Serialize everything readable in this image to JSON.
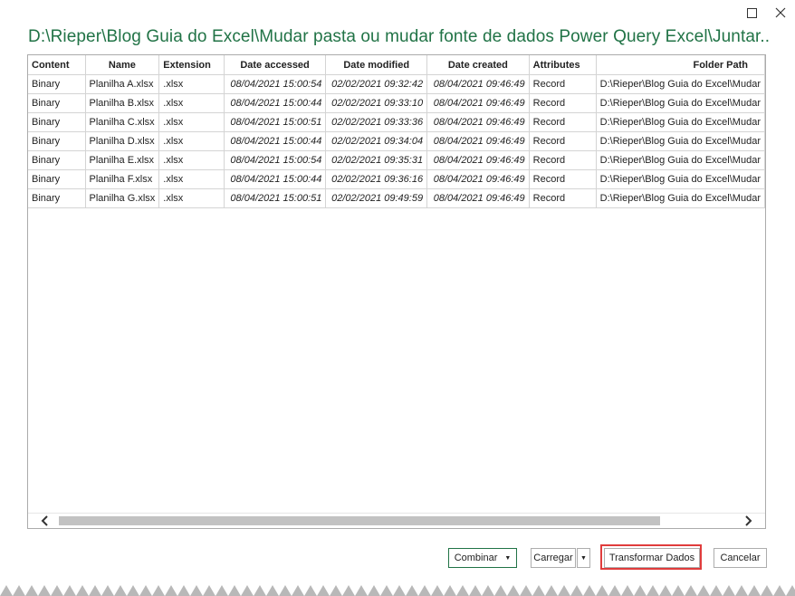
{
  "window": {
    "title": "D:\\Rieper\\Blog Guia do Excel\\Mudar pasta ou mudar fonte de dados Power Query Excel\\Juntar..."
  },
  "table": {
    "columns": [
      "Content",
      "Name",
      "Extension",
      "Date accessed",
      "Date modified",
      "Date created",
      "Attributes",
      "Folder Path"
    ],
    "rows": [
      [
        "Binary",
        "Planilha A.xlsx",
        ".xlsx",
        "08/04/2021 15:00:54",
        "02/02/2021 09:32:42",
        "08/04/2021 09:46:49",
        "Record",
        "D:\\Rieper\\Blog Guia do Excel\\Mudar"
      ],
      [
        "Binary",
        "Planilha B.xlsx",
        ".xlsx",
        "08/04/2021 15:00:44",
        "02/02/2021 09:33:10",
        "08/04/2021 09:46:49",
        "Record",
        "D:\\Rieper\\Blog Guia do Excel\\Mudar"
      ],
      [
        "Binary",
        "Planilha C.xlsx",
        ".xlsx",
        "08/04/2021 15:00:51",
        "02/02/2021 09:33:36",
        "08/04/2021 09:46:49",
        "Record",
        "D:\\Rieper\\Blog Guia do Excel\\Mudar"
      ],
      [
        "Binary",
        "Planilha D.xlsx",
        ".xlsx",
        "08/04/2021 15:00:44",
        "02/02/2021 09:34:04",
        "08/04/2021 09:46:49",
        "Record",
        "D:\\Rieper\\Blog Guia do Excel\\Mudar"
      ],
      [
        "Binary",
        "Planilha E.xlsx",
        ".xlsx",
        "08/04/2021 15:00:54",
        "02/02/2021 09:35:31",
        "08/04/2021 09:46:49",
        "Record",
        "D:\\Rieper\\Blog Guia do Excel\\Mudar"
      ],
      [
        "Binary",
        "Planilha F.xlsx",
        ".xlsx",
        "08/04/2021 15:00:44",
        "02/02/2021 09:36:16",
        "08/04/2021 09:46:49",
        "Record",
        "D:\\Rieper\\Blog Guia do Excel\\Mudar"
      ],
      [
        "Binary",
        "Planilha G.xlsx",
        ".xlsx",
        "08/04/2021 15:00:51",
        "02/02/2021 09:49:59",
        "08/04/2021 09:46:49",
        "Record",
        "D:\\Rieper\\Blog Guia do Excel\\Mudar"
      ]
    ]
  },
  "buttons": {
    "combinar": "Combinar",
    "carregar": "Carregar",
    "transformar": "Transformar Dados",
    "cancelar": "Cancelar"
  },
  "colors": {
    "title": "#217346",
    "highlight": "#e03c3c"
  },
  "icons": {
    "maximize": "maximize-icon",
    "close": "close-icon",
    "scroll_left": "chevron-left-icon",
    "scroll_right": "chevron-right-icon",
    "dropdown": "caret-down-icon"
  }
}
